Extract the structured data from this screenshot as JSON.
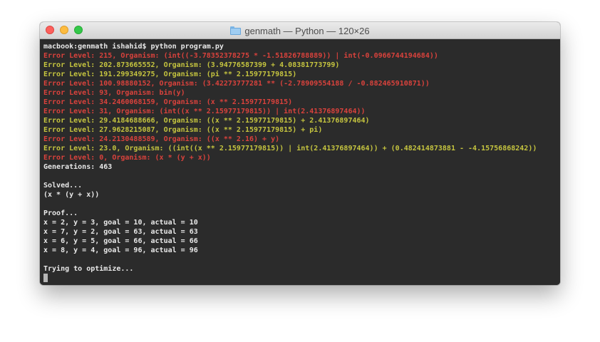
{
  "window": {
    "title": "genmath — Python — 120×26",
    "folder_icon": "folder-icon"
  },
  "colors": {
    "error_red": "#d9423c",
    "error_yellow": "#c5c43f",
    "text": "#e8e8e8",
    "background": "#2b2b2b"
  },
  "terminal": {
    "prompt": "macbook:genmath ishahid$ python program.py",
    "error_lines": [
      {
        "text": "Error Level: 215, Organism: (int((-3.78352378275 * -1.51826788889)) | int(-0.0966744194684))",
        "color": "red"
      },
      {
        "text": "Error Level: 202.873665552, Organism: (3.94776587399 + 4.08381773799)",
        "color": "yellow"
      },
      {
        "text": "Error Level: 191.299349275, Organism: (pi ** 2.15977179815)",
        "color": "yellow"
      },
      {
        "text": "Error Level: 100.98880152, Organism: (3.42273777281 ** (-2.78909554188 / -0.882465910871))",
        "color": "red"
      },
      {
        "text": "Error Level: 93, Organism: bin(y)",
        "color": "red"
      },
      {
        "text": "Error Level: 34.2460068159, Organism: (x ** 2.15977179815)",
        "color": "red"
      },
      {
        "text": "Error Level: 31, Organism: (int((x ** 2.15977179815)) | int(2.41376897464))",
        "color": "red"
      },
      {
        "text": "Error Level: 29.4184688666, Organism: ((x ** 2.15977179815) + 2.41376897464)",
        "color": "yellow"
      },
      {
        "text": "Error Level: 27.9628215087, Organism: ((x ** 2.15977179815) + pi)",
        "color": "yellow"
      },
      {
        "text": "Error Level: 24.2130488589, Organism: ((x ** 2.16) + y)",
        "color": "red"
      },
      {
        "text": "Error Level: 23.0, Organism: ((int((x ** 2.15977179815)) | int(2.41376897464)) + (0.482414873881 - -4.15756868242))",
        "color": "yellow"
      },
      {
        "text": "Error Level: 0, Organism: (x * (y + x))",
        "color": "red"
      }
    ],
    "generations": "Generations: 463",
    "solved_header": "Solved...",
    "solved_value": "(x * (y + x))",
    "proof_header": "Proof...",
    "proof_lines": [
      "x = 2, y = 3, goal = 10, actual = 10",
      "x = 7, y = 2, goal = 63, actual = 63",
      "x = 6, y = 5, goal = 66, actual = 66",
      "x = 8, y = 4, goal = 96, actual = 96"
    ],
    "status": "Trying to optimize..."
  }
}
